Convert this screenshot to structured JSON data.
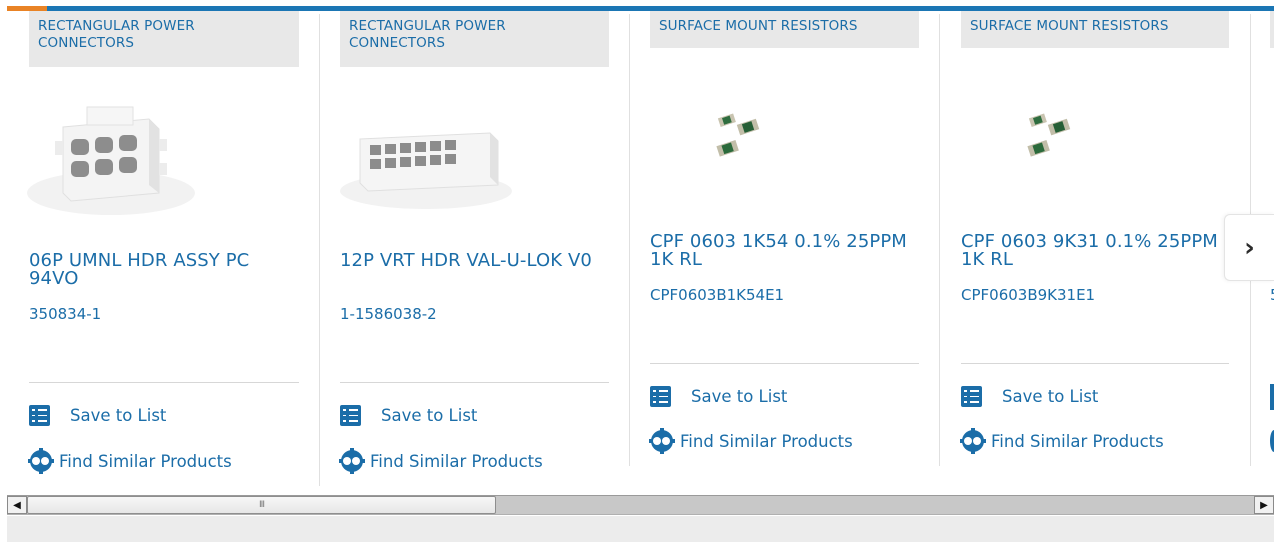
{
  "carousel": {
    "products": [
      {
        "category": "RECTANGULAR POWER CONNECTORS",
        "title": "06P UMNL HDR ASSY PC 94VO",
        "part_number": "350834-1",
        "image": "connector-6pin-image",
        "save_label": "Save to List",
        "similar_label": "Find Similar Products"
      },
      {
        "category": "RECTANGULAR POWER CONNECTORS",
        "title": "12P VRT HDR VAL-U-LOK V0",
        "part_number": "1-1586038-2",
        "image": "connector-12pin-image",
        "save_label": "Save to List",
        "similar_label": "Find Similar Products"
      },
      {
        "category": "SURFACE MOUNT RESISTORS",
        "title": "CPF 0603 1K54 0.1% 25PPM 1K RL",
        "part_number": "CPF0603B1K54E1",
        "image": "smd-resistor-image",
        "save_label": "Save to List",
        "similar_label": "Find Similar Products"
      },
      {
        "category": "SURFACE MOUNT RESISTORS",
        "title": "CPF 0603 9K31 0.1% 25PPM 1K RL",
        "part_number": "CPF0603B9K31E1",
        "image": "smd-resistor-image",
        "save_label": "Save to List",
        "similar_label": "Find Similar Products"
      }
    ],
    "partial_next_card": {
      "part_number_fragment": "5"
    },
    "next_icon": "chevron-right-icon",
    "next_glyph": "›"
  },
  "scrollbar": {
    "left_arrow": "◀",
    "right_arrow": "▶",
    "grip": "III"
  },
  "colors": {
    "brand_blue": "#1b6da8",
    "accent_orange": "#e98325",
    "top_bar_blue": "#1b76b4"
  }
}
